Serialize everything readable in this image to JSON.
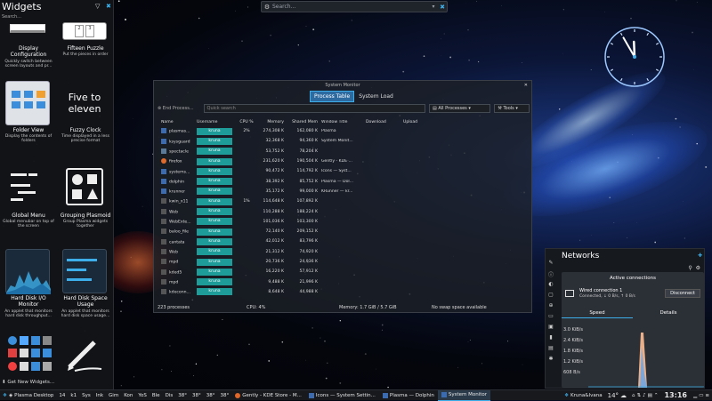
{
  "colors": {
    "accent": "#3daee9",
    "user_badge": "#1e9c9a",
    "panel_bg": "#121418"
  },
  "top_search": {
    "placeholder": "Search..."
  },
  "widgets": {
    "title": "Widgets",
    "search_placeholder": "Search...",
    "items": [
      {
        "title": "Display Configuration",
        "desc": "Quickly switch between screen layouts and pr..."
      },
      {
        "title": "Fifteen Puzzle",
        "desc": "Put the pieces in order"
      },
      {
        "title": "Folder View",
        "desc": "Display the contents of folders"
      },
      {
        "title": "Fuzzy Clock",
        "desc": "Time displayed in a less precise format",
        "thumb_text": "Five to eleven"
      },
      {
        "title": "Global Menu",
        "desc": "Global menubar on top of the screen"
      },
      {
        "title": "Grouping Plasmoid",
        "desc": "Group Plasma widgets together"
      },
      {
        "title": "Hard Disk I/O Monitor",
        "desc": "An applet that monitors hard disk throughput..."
      },
      {
        "title": "Hard Disk Space Usage",
        "desc": "An applet that monitors hard disk space usage..."
      }
    ],
    "fifteen_tiles": [
      "2",
      "3",
      "5"
    ],
    "get_new": "Get New Widgets..."
  },
  "sysmon": {
    "title": "System Monitor",
    "tabs": [
      "Process Table",
      "System Load"
    ],
    "end_process": "End Process...",
    "quick_search": "Quick search",
    "filter": "All Processes",
    "tools": "Tools",
    "columns": [
      "Name",
      "Username",
      "CPU %",
      "Memory",
      "Shared Mem",
      "Window Title",
      "Download",
      "Upload"
    ],
    "rows": [
      {
        "name": "plasmas...",
        "user": "kruna",
        "cpu": "2%",
        "mem": "274,308 K",
        "shr": "162,080 K",
        "win": "Plasma"
      },
      {
        "name": "ksysguard",
        "user": "kruna",
        "cpu": "",
        "mem": "32,368 K",
        "shr": "94,360 K",
        "win": "System Monit..."
      },
      {
        "name": "spectacle",
        "user": "kruna",
        "cpu": "",
        "mem": "53,752 K",
        "shr": "78,204 K",
        "win": ""
      },
      {
        "name": "firefox",
        "user": "kruna",
        "cpu": "",
        "mem": "231,620 K",
        "shr": "190,504 K",
        "win": "Gently - KDE ..."
      },
      {
        "name": "systems...",
        "user": "kruna",
        "cpu": "",
        "mem": "90,472 K",
        "shr": "114,792 K",
        "win": "Icons — Syst..."
      },
      {
        "name": "dolphin",
        "user": "kruna",
        "cpu": "",
        "mem": "38,392 K",
        "shr": "85,752 K",
        "win": "Plasma — Dol..."
      },
      {
        "name": "krunner",
        "user": "kruna",
        "cpu": "",
        "mem": "35,172 K",
        "shr": "99,000 K",
        "win": "KRunner — kr..."
      },
      {
        "name": "kwin_x11",
        "user": "kruna",
        "cpu": "1%",
        "mem": "114,648 K",
        "shr": "107,892 K",
        "win": ""
      },
      {
        "name": "Web",
        "user": "kruna",
        "cpu": "",
        "mem": "110,288 K",
        "shr": "188,224 K",
        "win": ""
      },
      {
        "name": "WebExte...",
        "user": "kruna",
        "cpu": "",
        "mem": "101,036 K",
        "shr": "103,300 K",
        "win": ""
      },
      {
        "name": "baloo_file",
        "user": "kruna",
        "cpu": "",
        "mem": "72,140 K",
        "shr": "209,152 K",
        "win": ""
      },
      {
        "name": "cantata",
        "user": "kruna",
        "cpu": "",
        "mem": "42,012 K",
        "shr": "83,796 K",
        "win": ""
      },
      {
        "name": "Web",
        "user": "kruna",
        "cpu": "",
        "mem": "21,312 K",
        "shr": "74,920 K",
        "win": ""
      },
      {
        "name": "mpd",
        "user": "kruna",
        "cpu": "",
        "mem": "20,736 K",
        "shr": "24,936 K",
        "win": ""
      },
      {
        "name": "kded5",
        "user": "kruna",
        "cpu": "",
        "mem": "16,220 K",
        "shr": "57,912 K",
        "win": ""
      },
      {
        "name": "mpd",
        "user": "kruna",
        "cpu": "",
        "mem": "9,488 K",
        "shr": "21,996 K",
        "win": ""
      },
      {
        "name": "kdeconn...",
        "user": "kruna",
        "cpu": "",
        "mem": "8,648 K",
        "shr": "44,988 K",
        "win": ""
      }
    ],
    "status": {
      "processes": "223 processes",
      "cpu": "CPU: 4%",
      "memory": "Memory: 1.7 GiB / 5.7 GiB",
      "swap": "No swap space available"
    }
  },
  "clock": {
    "hour": 11,
    "minute": 55
  },
  "networks": {
    "title": "Networks",
    "active_connections": "Active connections",
    "connection_name": "Wired connection 1",
    "connection_status": "Connected, ↓ 0 B/s, ↑ 0 B/s",
    "disconnect": "Disconnect",
    "tabs": [
      "Speed",
      "Details"
    ],
    "yticks": [
      "3.0 KiB/s",
      "2.4 KiB/s",
      "1.8 KiB/s",
      "1.2 KiB/s",
      "608 B/s"
    ]
  },
  "taskbar": {
    "start": "Plasma Desktop",
    "indicators": [
      "14",
      "k1",
      "Sys",
      "Ink",
      "Gim",
      "Kon",
      "YoS",
      "Ble",
      "Dis"
    ],
    "temps": [
      "38°",
      "38°",
      "38°",
      "38°"
    ],
    "tasks": [
      {
        "label": "Gently - KDE Store - M...",
        "active": false
      },
      {
        "label": "Icons — System Settin...",
        "active": false
      },
      {
        "label": "Plasma — Dolphin",
        "active": false
      },
      {
        "label": "System Monitor",
        "active": true
      }
    ],
    "weather": "14°",
    "user": "Kruna&Ivana",
    "time": "13:16"
  }
}
